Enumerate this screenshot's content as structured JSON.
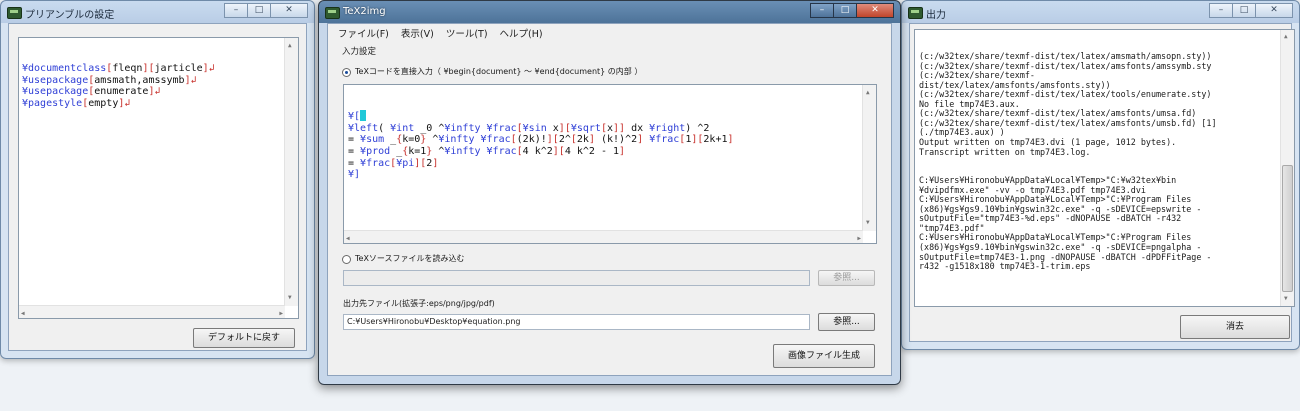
{
  "preamble_window": {
    "title": "プリアンブルの設定",
    "lines": [
      [
        {
          "t": "¥documentclass",
          "c": "blue"
        },
        {
          "t": "[",
          "c": "red"
        },
        {
          "t": "fleqn",
          "c": "dark"
        },
        {
          "t": "][",
          "c": "red"
        },
        {
          "t": "jarticle",
          "c": "dark"
        },
        {
          "t": "]",
          "c": "red"
        },
        {
          "t": "↲",
          "c": "ret"
        }
      ],
      [
        {
          "t": "¥usepackage",
          "c": "blue"
        },
        {
          "t": "[",
          "c": "red"
        },
        {
          "t": "amsmath,amssymb",
          "c": "dark"
        },
        {
          "t": "]",
          "c": "red"
        },
        {
          "t": "↲",
          "c": "ret"
        }
      ],
      [
        {
          "t": "¥usepackage",
          "c": "blue"
        },
        {
          "t": "[",
          "c": "red"
        },
        {
          "t": "enumerate",
          "c": "dark"
        },
        {
          "t": "]",
          "c": "red"
        },
        {
          "t": "↲",
          "c": "ret"
        }
      ],
      [
        {
          "t": "¥pagestyle",
          "c": "blue"
        },
        {
          "t": "[",
          "c": "red"
        },
        {
          "t": "empty",
          "c": "dark"
        },
        {
          "t": "]",
          "c": "red"
        },
        {
          "t": "↲",
          "c": "ret"
        }
      ]
    ],
    "default_button": "デフォルトに戻す"
  },
  "main_window": {
    "title": "TeX2img",
    "menu": [
      "ファイル(F)",
      "表示(V)",
      "ツール(T)",
      "ヘルプ(H)"
    ],
    "group_label": "入力設定",
    "radio_direct": "TeXコードを直接入力（ ¥begin{document} 〜 ¥end{document} の内部 ）",
    "code_lines": [
      [
        {
          "t": "¥[",
          "c": "blue"
        },
        {
          "t": "",
          "c": "caret"
        }
      ],
      [
        {
          "t": "¥left",
          "c": "blue"
        },
        {
          "t": "( ",
          "c": "dark"
        },
        {
          "t": "¥int",
          "c": "blue"
        },
        {
          "t": " _0 ^",
          "c": "dark"
        },
        {
          "t": "¥infty",
          "c": "blue"
        },
        {
          "t": " ",
          "c": "dark"
        },
        {
          "t": "¥frac",
          "c": "blue"
        },
        {
          "t": "[",
          "c": "red"
        },
        {
          "t": "¥sin",
          "c": "blue"
        },
        {
          "t": " x",
          "c": "dark"
        },
        {
          "t": "][",
          "c": "red"
        },
        {
          "t": "¥sqrt",
          "c": "blue"
        },
        {
          "t": "[",
          "c": "red"
        },
        {
          "t": "x",
          "c": "dark"
        },
        {
          "t": "]]",
          "c": "red"
        },
        {
          "t": " dx ",
          "c": "dark"
        },
        {
          "t": "¥right",
          "c": "blue"
        },
        {
          "t": ") ^2",
          "c": "dark"
        }
      ],
      [
        {
          "t": "= ",
          "c": "dark"
        },
        {
          "t": "¥sum",
          "c": "blue"
        },
        {
          "t": " _",
          "c": "dark"
        },
        {
          "t": "{",
          "c": "red"
        },
        {
          "t": "k=0",
          "c": "dark"
        },
        {
          "t": "}",
          "c": "red"
        },
        {
          "t": " ^",
          "c": "dark"
        },
        {
          "t": "¥infty",
          "c": "blue"
        },
        {
          "t": " ",
          "c": "dark"
        },
        {
          "t": "¥frac",
          "c": "blue"
        },
        {
          "t": "[",
          "c": "red"
        },
        {
          "t": "(2k)!",
          "c": "dark"
        },
        {
          "t": "][",
          "c": "red"
        },
        {
          "t": "2^",
          "c": "dark"
        },
        {
          "t": "[",
          "c": "red"
        },
        {
          "t": "2k",
          "c": "dark"
        },
        {
          "t": "]",
          "c": "red"
        },
        {
          "t": " (k!)^2",
          "c": "dark"
        },
        {
          "t": "]",
          "c": "red"
        },
        {
          "t": " ",
          "c": "dark"
        },
        {
          "t": "¥frac",
          "c": "blue"
        },
        {
          "t": "[",
          "c": "red"
        },
        {
          "t": "1",
          "c": "dark"
        },
        {
          "t": "][",
          "c": "red"
        },
        {
          "t": "2k+1",
          "c": "dark"
        },
        {
          "t": "]",
          "c": "red"
        }
      ],
      [
        {
          "t": "= ",
          "c": "dark"
        },
        {
          "t": "¥prod",
          "c": "blue"
        },
        {
          "t": " _",
          "c": "dark"
        },
        {
          "t": "{",
          "c": "red"
        },
        {
          "t": "k=1",
          "c": "dark"
        },
        {
          "t": "}",
          "c": "red"
        },
        {
          "t": " ^",
          "c": "dark"
        },
        {
          "t": "¥infty",
          "c": "blue"
        },
        {
          "t": " ",
          "c": "dark"
        },
        {
          "t": "¥frac",
          "c": "blue"
        },
        {
          "t": "[",
          "c": "red"
        },
        {
          "t": "4 k^2",
          "c": "dark"
        },
        {
          "t": "][",
          "c": "red"
        },
        {
          "t": "4 k^2 - 1",
          "c": "dark"
        },
        {
          "t": "]",
          "c": "red"
        }
      ],
      [
        {
          "t": "= ",
          "c": "dark"
        },
        {
          "t": "¥frac",
          "c": "blue"
        },
        {
          "t": "[",
          "c": "red"
        },
        {
          "t": "¥pi",
          "c": "blue"
        },
        {
          "t": "][",
          "c": "red"
        },
        {
          "t": "2",
          "c": "dark"
        },
        {
          "t": "]",
          "c": "red"
        }
      ],
      [
        {
          "t": "¥]",
          "c": "blue"
        }
      ]
    ],
    "radio_file": "TeXソースファイルを読み込む",
    "browse_disabled": "参照...",
    "output_label": "出力先ファイル(拡張子:eps/png/jpg/pdf)",
    "output_value": "C:¥Users¥Hironobu¥Desktop¥equation.png",
    "browse": "参照...",
    "generate_button": "画像ファイル生成"
  },
  "output_window": {
    "title": "出力",
    "log": "(c:/w32tex/share/texmf-dist/tex/latex/amsmath/amsopn.sty))\n(c:/w32tex/share/texmf-dist/tex/latex/amsfonts/amssymb.sty\n(c:/w32tex/share/texmf-\ndist/tex/latex/amsfonts/amsfonts.sty))\n(c:/w32tex/share/texmf-dist/tex/latex/tools/enumerate.sty)\nNo file tmp74E3.aux.\n(c:/w32tex/share/texmf-dist/tex/latex/amsfonts/umsa.fd)\n(c:/w32tex/share/texmf-dist/tex/latex/amsfonts/umsb.fd) [1]\n(./tmp74E3.aux) )\nOutput written on tmp74E3.dvi (1 page, 1012 bytes).\nTranscript written on tmp74E3.log.\n\n\nC:¥Users¥Hironobu¥AppData¥Local¥Temp>\"C:¥w32tex¥bin\n¥dvipdfmx.exe\" -vv -o tmp74E3.pdf tmp74E3.dvi\nC:¥Users¥Hironobu¥AppData¥Local¥Temp>\"C:¥Program Files\n(x86)¥gs¥gs9.10¥bin¥gswin32c.exe\" -q -sDEVICE=epswrite -\nsOutputFile=\"tmp74E3-%d.eps\" -dNOPAUSE -dBATCH -r432\n\"tmp74E3.pdf\"\nC:¥Users¥Hironobu¥AppData¥Local¥Temp>\"C:¥Program Files\n(x86)¥gs¥gs9.10¥bin¥gswin32c.exe\" -q -sDEVICE=pngalpha -\nsOutputFile=tmp74E3-1.png -dNOPAUSE -dBATCH -dPDFFitPage -\nr432 -g1518x180 tmp74E3-1-trim.eps",
    "clear_button": "消去"
  },
  "caption": {
    "minimize": "–",
    "maximize": "□",
    "close": "✕"
  },
  "colors": {
    "blue": "#2f3fd6",
    "red": "#c8322d",
    "dark": "#111111",
    "caret": "#20c8d8"
  }
}
